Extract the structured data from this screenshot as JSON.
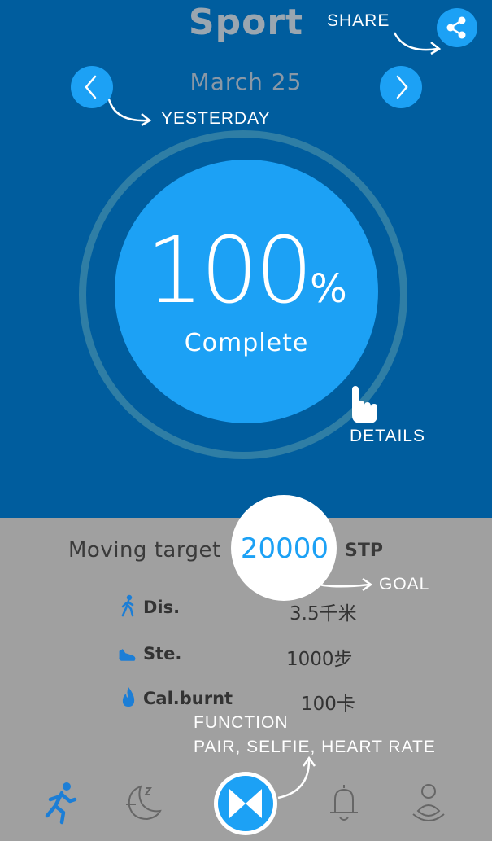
{
  "header": {
    "title": "Sport",
    "date": "March 25"
  },
  "progress": {
    "percent_value": "100",
    "percent_sign": "%",
    "complete_label": "Complete",
    "percent": 100
  },
  "goal": {
    "label": "Moving target",
    "value": "20000",
    "unit": "STP"
  },
  "stats": [
    {
      "label": "Dis.",
      "value": "3.5千米",
      "icon": "walking-person-icon"
    },
    {
      "label": "Ste.",
      "value": "1000步",
      "icon": "shoe-icon"
    },
    {
      "label": "Cal.burnt",
      "value": "100卡",
      "icon": "flame-icon"
    }
  ],
  "annotations": {
    "share": "SHARE",
    "yesterday": "YESTERDAY",
    "details": "DETAILS",
    "goal": "GOAL",
    "function_line1": "FUNCTION",
    "function_line2": "PAIR, SELFIE, HEART RATE"
  },
  "tabs": [
    "running-person-icon",
    "sleep-moon-icon",
    "function-bowtie-icon",
    "bell-icon",
    "person-meditation-icon"
  ],
  "colors": {
    "top_bg": "#005d9e",
    "accent": "#1ca1f5",
    "bottom_bg": "#a0a0a0",
    "ring": "#2f7ea5"
  }
}
